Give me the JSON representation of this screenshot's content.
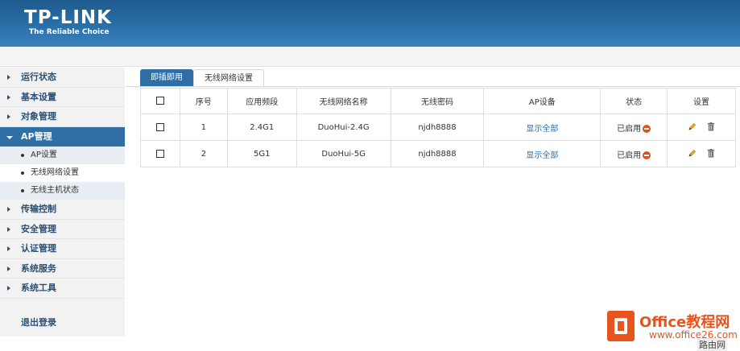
{
  "brand": {
    "name": "TP-LINK",
    "tagline": "The Reliable Choice"
  },
  "sidebar": {
    "items": [
      {
        "label": "运行状态"
      },
      {
        "label": "基本设置"
      },
      {
        "label": "对象管理"
      },
      {
        "label": "AP管理",
        "active": true,
        "sub": [
          {
            "label": "AP设置"
          },
          {
            "label": "无线网络设置"
          },
          {
            "label": "无线主机状态"
          }
        ]
      },
      {
        "label": "传输控制"
      },
      {
        "label": "安全管理"
      },
      {
        "label": "认证管理"
      },
      {
        "label": "系统服务"
      },
      {
        "label": "系统工具"
      }
    ],
    "logout": "退出登录"
  },
  "tabs": [
    {
      "label": "即插即用",
      "active": true
    },
    {
      "label": "无线网络设置"
    }
  ],
  "table": {
    "headers": [
      "序号",
      "应用频段",
      "无线网络名称",
      "无线密码",
      "AP设备",
      "状态",
      "设置"
    ],
    "rows": [
      {
        "index": "1",
        "band": "2.4G1",
        "ssid": "DuoHui-2.4G",
        "password": "njdh8888",
        "ap": "显示全部",
        "status": "已启用"
      },
      {
        "index": "2",
        "band": "5G1",
        "ssid": "DuoHui-5G",
        "password": "njdh8888",
        "ap": "显示全部",
        "status": "已启用"
      }
    ]
  },
  "icons": {
    "status": "stop-circle-icon",
    "edit": "pencil-icon",
    "delete": "trash-icon"
  },
  "colors": {
    "header": "#2a6fa8",
    "active_nav": "#2f6fa6",
    "status_icon": "#d9531e",
    "watermark": "#e8541e"
  },
  "watermark": {
    "title": "Office教程网",
    "url": "www.office26.com",
    "corner": "路由网"
  }
}
